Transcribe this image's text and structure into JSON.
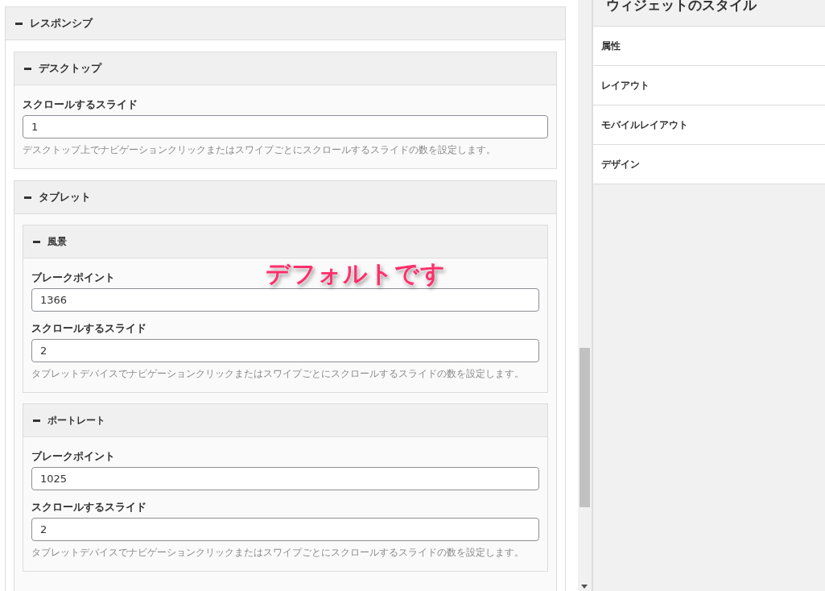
{
  "sections": [
    {
      "title": "レスポンシブ",
      "expanded": true,
      "children": [
        {
          "title": "デスクトップ",
          "expanded": true,
          "fields": [
            {
              "label": "スクロールするスライド",
              "value": "1",
              "help": "デスクトップ上でナビゲーションクリックまたはスワイプごとにスクロールするスライドの数を設定します。"
            }
          ]
        },
        {
          "title": "タブレット",
          "expanded": true,
          "children": [
            {
              "title": "風景",
              "expanded": true,
              "fields": [
                {
                  "label": "ブレークポイント",
                  "value": "1366"
                },
                {
                  "label": "スクロールするスライド",
                  "value": "2",
                  "help": "タブレットデバイスでナビゲーションクリックまたはスワイプごとにスクロールするスライドの数を設定します。"
                }
              ]
            },
            {
              "title": "ポートレート",
              "expanded": true,
              "fields": [
                {
                  "label": "ブレークポイント",
                  "value": "1025"
                },
                {
                  "label": "スクロールするスライド",
                  "value": "2",
                  "help": "タブレットデバイスでナビゲーションクリックまたはスワイプごとにスクロールするスライドの数を設定します。"
                }
              ]
            }
          ]
        }
      ]
    }
  ],
  "side_panel": {
    "title": "ウィジェットのスタイル",
    "items": [
      {
        "label": "属性"
      },
      {
        "label": "レイアウト"
      },
      {
        "label": "モバイルレイアウト"
      },
      {
        "label": "デザイン"
      }
    ]
  },
  "annotation": "デフォルトです"
}
